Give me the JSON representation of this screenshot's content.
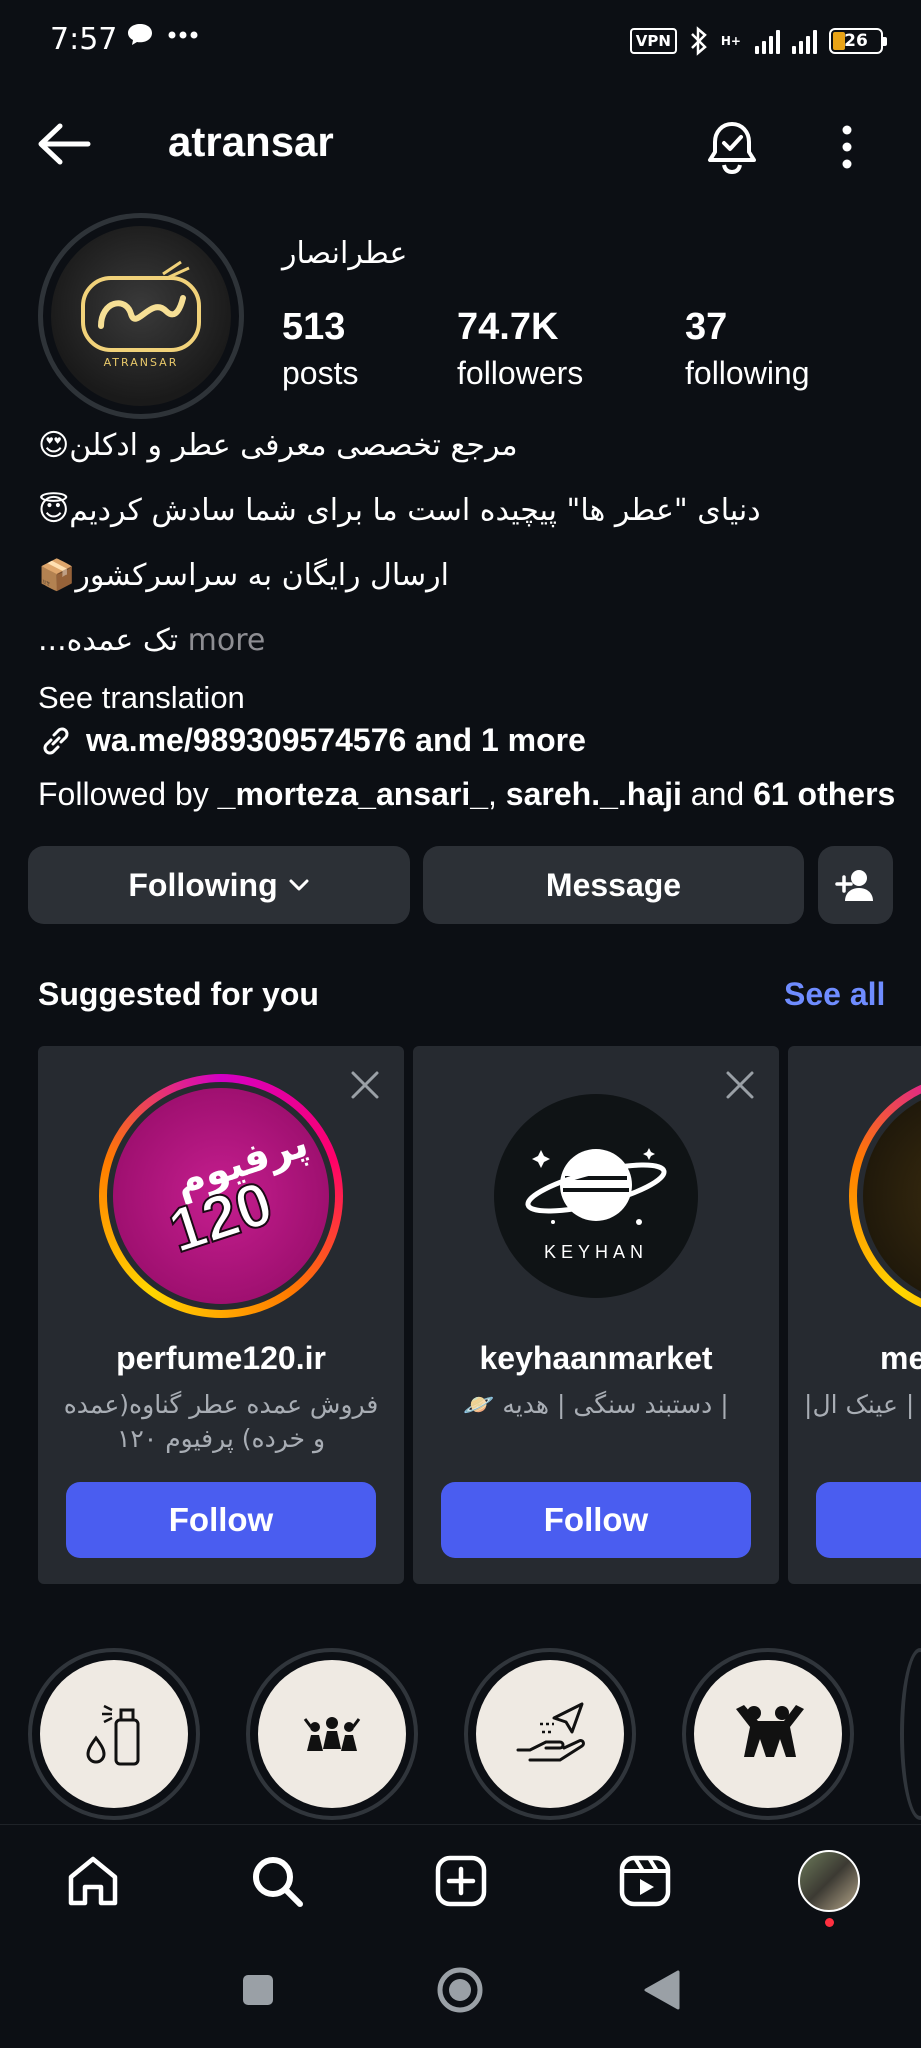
{
  "status_bar": {
    "time": "7:57",
    "left_icons": [
      "chat-bubble-icon",
      "ellipsis-icon"
    ],
    "vpn_label": "VPN",
    "network_type": "H+",
    "battery_level": "26"
  },
  "header": {
    "username": "atransar",
    "icons": [
      "back-arrow-icon",
      "notification-bell-icon",
      "more-vertical-icon"
    ]
  },
  "profile": {
    "avatar_text": "ATRANSAR",
    "full_name": "عطرانصار",
    "stats": {
      "posts_count": "513",
      "posts_label": "posts",
      "followers_count": "74.7K",
      "followers_label": "followers",
      "following_count": "37",
      "following_label": "following"
    },
    "bio": {
      "line1": "مرجع تخصصی معرفی عطر و ادکلن😍",
      "line2": "دنیای \"عطر ها\" پیچیده است ما برای شما سادش کردیم😇",
      "line3": "ارسال رایگان به سراسرکشور📦",
      "line4_text": "تک عمده...",
      "line4_more": "more"
    },
    "see_translation": "See translation",
    "link": "wa.me/989309574576 and 1 more",
    "followed_by": {
      "prefix": "Followed by ",
      "user1": "_morteza_ansari_",
      "sep": ", ",
      "user2": "sareh._.haji",
      "and": " and ",
      "others": "61 others"
    }
  },
  "actions": {
    "following_label": "Following",
    "message_label": "Message"
  },
  "suggested": {
    "title": "Suggested for you",
    "see_all": "See all",
    "follow_label": "Follow",
    "cards": [
      {
        "username": "perfume120.ir",
        "subtitle": "فروش عمده عطر گناوه(عمده و خرده) پرفیوم ۱۲۰",
        "logo_top": "پرفیوم",
        "logo_num": "120"
      },
      {
        "username": "keyhaanmarket",
        "subtitle": "| دستبند سنگی | هدیه 🪐",
        "logo_text": "KEYHAN"
      },
      {
        "username": "me",
        "subtitle": "بی | عینک ال|"
      }
    ]
  },
  "highlights": [
    "perfume-spray-icon",
    "group-people-icon",
    "hand-send-icon",
    "people-cheering-icon"
  ],
  "bottom_nav": [
    "home-icon",
    "search-icon",
    "create-post-icon",
    "reels-icon",
    "profile-icon"
  ],
  "system_nav": [
    "recent-apps-icon",
    "home-circle-icon",
    "back-triangle-icon"
  ]
}
